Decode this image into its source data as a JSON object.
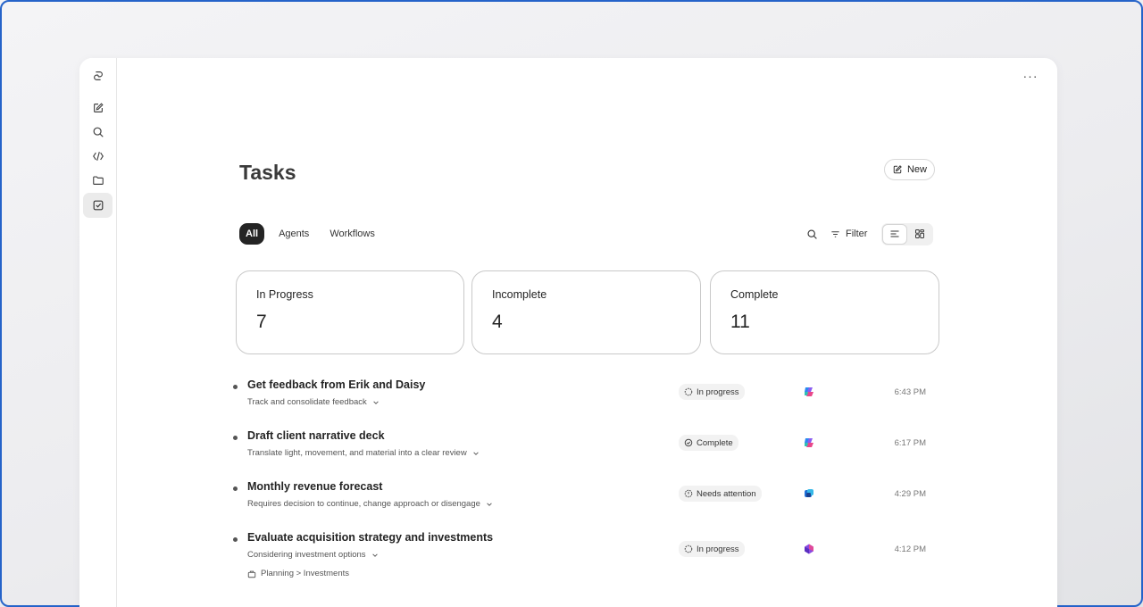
{
  "sidebar": {
    "items": [
      {
        "icon": "copilot-logo-icon"
      },
      {
        "icon": "new-chat-icon"
      },
      {
        "icon": "search-icon"
      },
      {
        "icon": "code-icon"
      },
      {
        "icon": "folder-icon"
      },
      {
        "icon": "tasks-checkbox-icon",
        "active": true
      }
    ]
  },
  "header": {
    "more_label": "···"
  },
  "page": {
    "title": "Tasks",
    "new_label": "New"
  },
  "tabs": [
    {
      "label": "All",
      "active": true
    },
    {
      "label": "Agents"
    },
    {
      "label": "Workflows"
    }
  ],
  "toolbar": {
    "filter_label": "Filter"
  },
  "summary": [
    {
      "label": "In Progress",
      "value": "7"
    },
    {
      "label": "Incomplete",
      "value": "4"
    },
    {
      "label": "Complete",
      "value": "11"
    }
  ],
  "tasks": [
    {
      "title": "Get feedback from Erik and Daisy",
      "subtitle": "Track and consolidate feedback",
      "status": "In progress",
      "status_icon": "progress-circle-icon",
      "agent_icon": "copilot-icon",
      "time": "6:43 PM"
    },
    {
      "title": "Draft client narrative deck",
      "subtitle": "Translate light, movement, and material into a clear review",
      "status": "Complete",
      "status_icon": "check-circle-icon",
      "agent_icon": "copilot-icon",
      "time": "6:17 PM"
    },
    {
      "title": "Monthly revenue forecast",
      "subtitle": "Requires decision to continue, change approach or disengage",
      "status": "Needs attention",
      "status_icon": "alert-circle-icon",
      "agent_icon": "analyst-agent-icon",
      "time": "4:29 PM"
    },
    {
      "title": "Evaluate acquisition strategy and investments",
      "subtitle": "Considering investment options",
      "breadcrumb": "Planning > Investments",
      "status": "In progress",
      "status_icon": "progress-circle-icon",
      "agent_icon": "researcher-agent-icon",
      "time": "4:12 PM"
    }
  ],
  "colors": {
    "accent_dark": "#242424",
    "frame_border": "#2563c9",
    "status_bg": "#f2f2f2"
  }
}
